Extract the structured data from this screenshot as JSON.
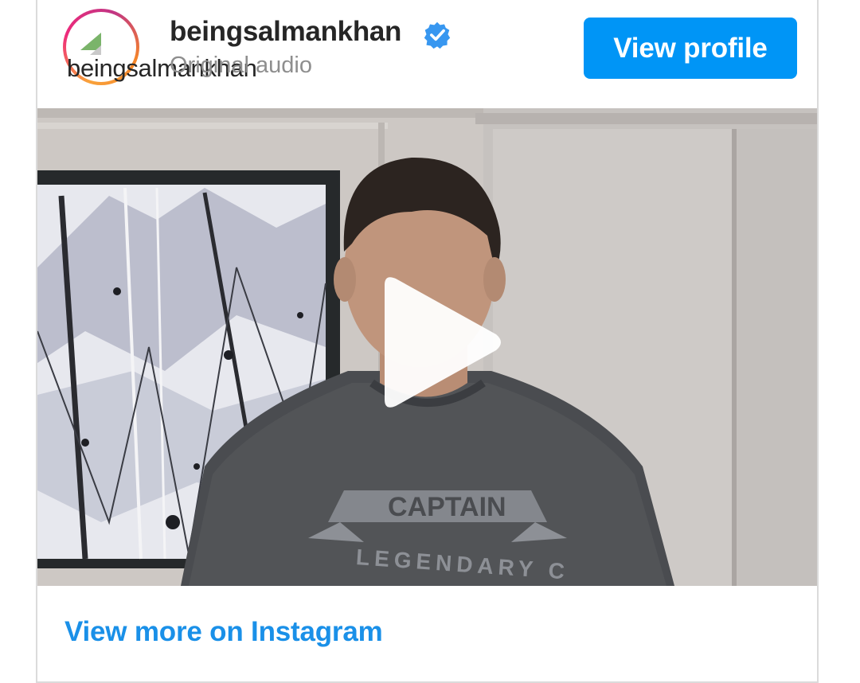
{
  "header": {
    "avatar_alt": "beingsalmankhan",
    "username": "beingsalmankhan",
    "subtitle": "Original audio",
    "verified_icon": "verified-badge-icon",
    "view_profile_label": "View profile"
  },
  "media": {
    "type": "video",
    "play_icon": "play-icon",
    "shirt_text_top": "CAPTAIN",
    "shirt_text_bottom": "LEGENDARY C"
  },
  "footer": {
    "view_more_label": "View more on Instagram"
  },
  "colors": {
    "button_blue": "#0095f6",
    "link_blue": "#1a90e8",
    "verified_blue": "#3897f0"
  }
}
